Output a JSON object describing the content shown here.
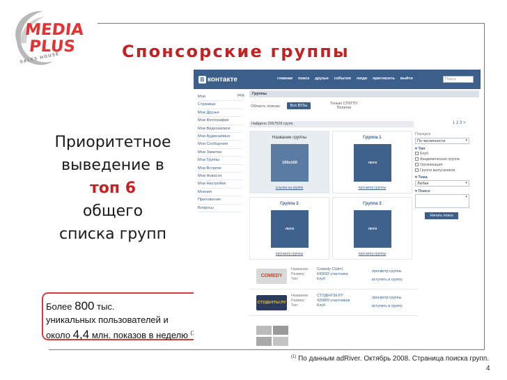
{
  "brand": {
    "line1": "MEDIA",
    "line2": "PLUS",
    "tagline": "SALES HOUSE",
    "color": "#e53233"
  },
  "slide": {
    "title": "Спонсорские группы",
    "left_lines": [
      "Приоритетное",
      "выведение в",
      "топ 6",
      "общего",
      "списка групп"
    ],
    "info": {
      "l1_pre": "Более ",
      "l1_num": "800",
      "l1_post": " тыс.",
      "l2": "уникальных пользователей и",
      "l3_pre": "около ",
      "l3_num": "4,4",
      "l3_post": " млн. показов в неделю ",
      "l3_sup": "(1)"
    },
    "footnote_sup": "(1)",
    "footnote": " По данным adRiver. Октябрь 2008. Страница поиска групп.",
    "page_number": "4",
    "accent_color": "#c42222"
  },
  "screenshot": {
    "logo_letter": "В",
    "logo_text": "контакте",
    "nav": [
      "главная",
      "поиск",
      "друзья",
      "события",
      "люди",
      "пригласить",
      "выйти"
    ],
    "search_placeholder": "Поиск",
    "left_menu": [
      "Мои",
      "Страница",
      "Мои Друзья",
      "Мои Фотографии",
      "Мои Видеозаписи",
      "Мои Аудиозаписи",
      "Мои Сообщения",
      "Мои Заметки",
      "Мои Группы",
      "Мои Встречи",
      "Мои Новости",
      "Мои Настройки",
      "Мнения",
      "Приложения",
      "Вопросы"
    ],
    "left_edit": "ред.",
    "breadcrumb": "Группы",
    "area_label": "Область поиска:",
    "area_button": "Все ВУЗы",
    "area_option_1": "Только СПбГПУ",
    "area_option_2": "Политех",
    "found": "Найдено 2567529 групп.",
    "pager": "1 2 3 >",
    "cards": [
      {
        "title": "Название группы",
        "image": "100x100",
        "link": "ссылка на группу"
      },
      {
        "title": "Группа 1",
        "image": "лого",
        "link": "просмотр группы"
      },
      {
        "title": "Группа 2",
        "image": "лого",
        "link": "просмотр группы"
      },
      {
        "title": "Группа 3",
        "image": "лого",
        "link": "просмотр группы"
      }
    ],
    "results": [
      {
        "thumb": "COMEDY",
        "k1": "Название:",
        "k2": "Размер:",
        "k3": "Тип:",
        "v1": "Comedy Club=)",
        "v2": "643692 участника",
        "v3": "Клуб",
        "a1": "просмотр группы",
        "a2": "вступить в группу"
      },
      {
        "thumb": "СТУДЕНТЫ.РУ",
        "k1": "Название:",
        "k2": "Размер:",
        "k3": "Тип:",
        "v1": "СТУДЕНТЫ.РУ",
        "v2": "426869 участников",
        "v3": "Клуб",
        "a1": "просмотр группы",
        "a2": "вступить в группу"
      }
    ],
    "sidebar": {
      "order_label": "Порядок",
      "order_value": "По численности",
      "type_label": "Тип",
      "type_options": [
        "Клуб",
        "Академическая группа",
        "Организация",
        "Группа выпускников"
      ],
      "topic_label": "Тема",
      "topic_value": "Любая",
      "search_label": "Поиск",
      "search_button": "Начать поиск"
    },
    "colors": {
      "header": "#3b5f8a",
      "tile": "#3f628c"
    }
  }
}
